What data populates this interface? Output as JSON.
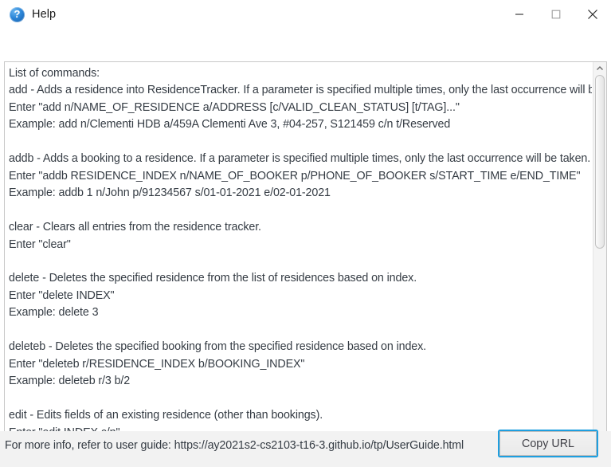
{
  "window": {
    "title": "Help",
    "icon": "help-circle-icon",
    "controls": {
      "minimize_label": "Minimize",
      "maximize_label": "Maximize",
      "close_label": "Close"
    }
  },
  "help_panel": {
    "text": "List of commands:\nadd - Adds a residence into ResidenceTracker. If a parameter is specified multiple times, only the last occurrence will be taken.\nEnter \"add n/NAME_OF_RESIDENCE a/ADDRESS [c/VALID_CLEAN_STATUS] [t/TAG]...\"\nExample: add n/Clementi HDB a/459A Clementi Ave 3, #04-257, S121459 c/n t/Reserved\n\naddb - Adds a booking to a residence. If a parameter is specified multiple times, only the last occurrence will be taken.\nEnter \"addb RESIDENCE_INDEX n/NAME_OF_BOOKER p/PHONE_OF_BOOKER s/START_TIME e/END_TIME\"\nExample: addb 1 n/John p/91234567 s/01-01-2021 e/02-01-2021\n\nclear - Clears all entries from the residence tracker.\nEnter \"clear\"\n\ndelete - Deletes the specified residence from the list of residences based on index.\nEnter \"delete INDEX\"\nExample: delete 3\n\ndeleteb - Deletes the specified booking from the specified residence based on index.\nEnter \"deleteb r/RESIDENCE_INDEX b/BOOKING_INDEX\"\nExample: deleteb r/3 b/2\n\nedit - Edits fields of an existing residence (other than bookings).\nEnter \"edit INDEX c/n\"",
    "scrollbars": {
      "vertical_up_icon": "chevron-up-icon",
      "vertical_down_icon": "chevron-down-icon",
      "horizontal_left_icon": "chevron-left-icon",
      "horizontal_right_icon": "chevron-right-icon"
    }
  },
  "footer": {
    "info_text": "For more info, refer to user guide: https://ay2021s2-cs2103-t16-3.github.io/tp/UserGuide.html",
    "copy_url_label": "Copy URL"
  },
  "colors": {
    "accent": "#1e9fe0",
    "text": "#353c44",
    "panel_border": "#c8c8c8",
    "footer_bg": "#f2f2f2",
    "icon_blue": "#2c86d8"
  }
}
